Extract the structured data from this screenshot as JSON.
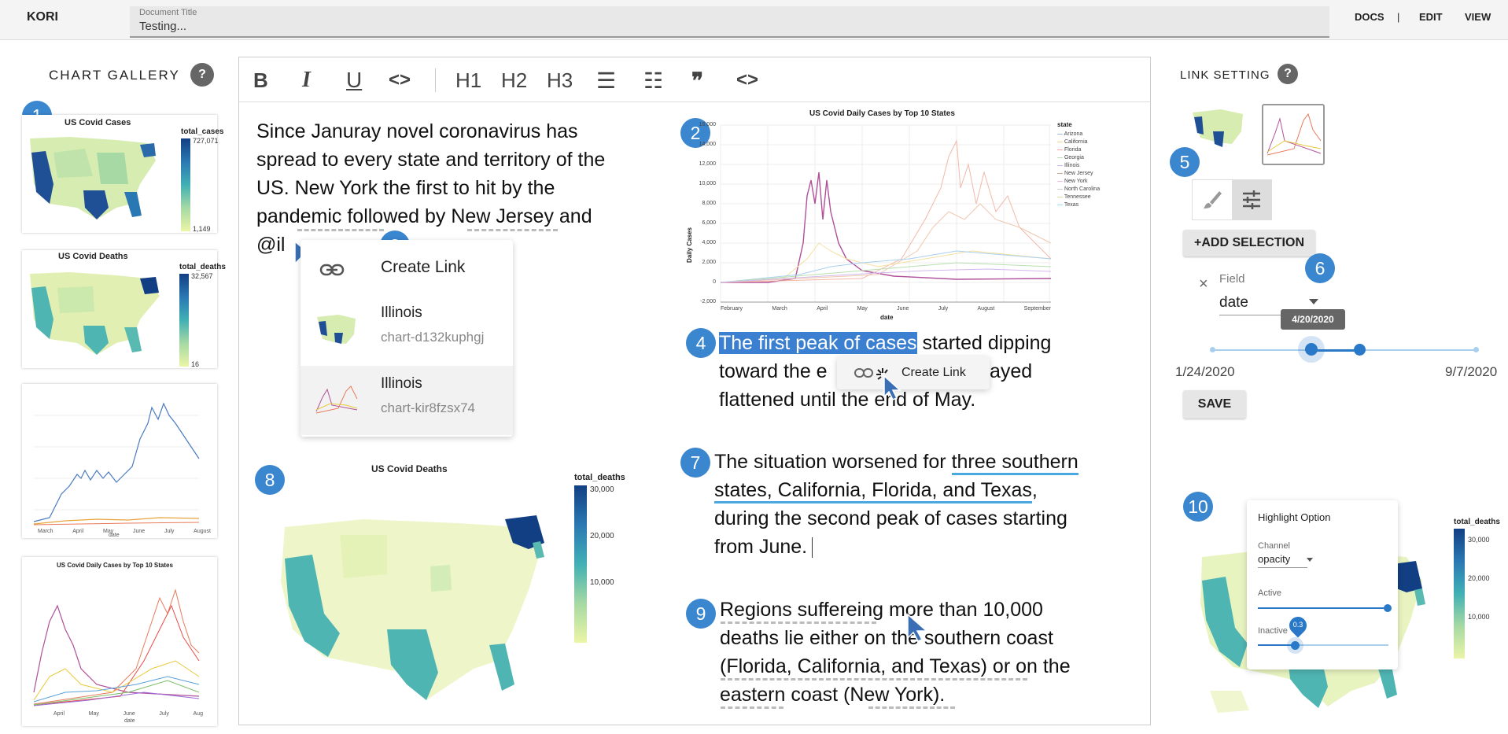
{
  "header": {
    "brand": "KORI",
    "doc_title_label": "Document Title",
    "doc_title_value": "Testing...",
    "nav": [
      "DOCS",
      "|",
      "EDIT",
      "VIEW"
    ]
  },
  "gallery": {
    "title": "CHART GALLERY",
    "help": "?",
    "badge": "1",
    "charts": [
      {
        "title": "US Covid Cases",
        "legend_title": "total_cases",
        "legend_max": "727,071",
        "legend_min": "1,149"
      },
      {
        "title": "US Covid Deaths",
        "legend_title": "total_deaths",
        "legend_max": "32,567",
        "legend_min": "16"
      },
      {
        "title": "",
        "xticks": [
          "March",
          "April",
          "May",
          "June",
          "July",
          "August"
        ],
        "xlabel": "date"
      },
      {
        "title": "US Covid Daily Cases by Top 10 States",
        "xticks": [
          "April",
          "May",
          "June",
          "July",
          "Aug"
        ],
        "xlabel": "date"
      }
    ]
  },
  "toolbar": {
    "bold": "B",
    "italic": "I",
    "underline": "U",
    "code": "<>",
    "h1": "H1",
    "h2": "H2",
    "h3": "H3",
    "bullet": "☰",
    "numbered": "☷",
    "quote": "❞",
    "code_block": "<>"
  },
  "editor": {
    "para1_lines": [
      "Since Januray novel coronavirus has",
      "spread to every state and territory of the",
      "US. New York the first to hit by the",
      "pandemic followed by New Jersey and",
      "@il"
    ],
    "badges": [
      "2",
      "3",
      "4",
      "7",
      "8",
      "9"
    ],
    "mention_popup": {
      "create_link": "Create Link",
      "items": [
        {
          "name": "Illinois",
          "id": "chart-d132kuphgj"
        },
        {
          "name": "Illinois",
          "id": "chart-kir8fzsx74"
        }
      ]
    },
    "line_chart": {
      "title": "US Covid Daily Cases by Top 10 States",
      "ylabel": "Daily Cases",
      "xlabel": "date",
      "yticks": [
        "16,000",
        "14,000",
        "12,000",
        "10,000",
        "8,000",
        "6,000",
        "4,000",
        "2,000",
        "0",
        "-2,000"
      ],
      "xticks": [
        "February",
        "March",
        "April",
        "May",
        "June",
        "July",
        "August",
        "September"
      ],
      "legend_title": "state",
      "legend": [
        "Arizona",
        "California",
        "Florida",
        "Georgia",
        "Illinois",
        "New Jersey",
        "New York",
        "North Carolina",
        "Tennessee",
        "Texas"
      ]
    },
    "para2": {
      "highlighted": "The first peak of cases",
      "rest1": " started dipping",
      "line2a": "toward the e",
      "line2b": " stayed",
      "line3": "flattened until the end of May.",
      "create_link": "Create Link"
    },
    "para3": {
      "l1a": "The situation worsened for ",
      "l1b": "three southern",
      "l2a": "states, California, Florida, and Texas",
      "l2b": ",",
      "l3": "during the second peak of cases starting",
      "l4": "from June."
    },
    "para4": {
      "l1a": "Regions suffereing",
      "l1b": " more than 10,000",
      "l2": "deaths lie either on the southern coast",
      "l3": "(Florida, California, and Texas) or on the",
      "l4": "eastern coast (New York)."
    },
    "map_chart": {
      "title": "US Covid Deaths",
      "legend_title": "total_deaths",
      "legend": [
        "30,000",
        "20,000",
        "10,000"
      ]
    }
  },
  "link_panel": {
    "title": "LINK SETTING",
    "help": "?",
    "badges": [
      "5",
      "6",
      "10"
    ],
    "add_selection": "+ADD SELECTION",
    "field_label": "Field",
    "field_value": "date",
    "tooltip": "4/20/2020",
    "range_min": "1/24/2020",
    "range_max": "9/7/2020",
    "save": "SAVE",
    "highlight": {
      "title": "Highlight Option",
      "channel_label": "Channel",
      "channel_value": "opacity",
      "active_label": "Active",
      "inactive_label": "Inactive",
      "inactive_value": "0.3",
      "legend_title": "total_deaths",
      "legend": [
        "30,000",
        "20,000",
        "10,000"
      ]
    }
  }
}
